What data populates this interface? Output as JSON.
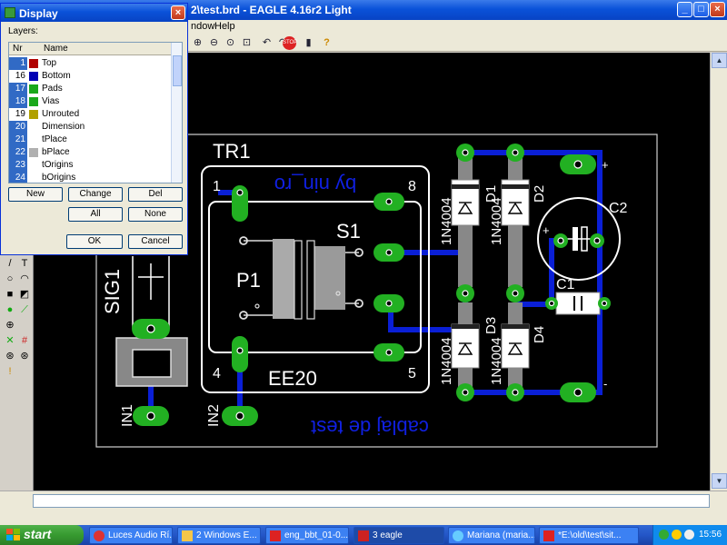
{
  "window": {
    "title": "2\\test.brd - EAGLE 4.16r2 Light"
  },
  "menubar": {
    "items": [
      "ndow",
      "Help"
    ]
  },
  "dialog": {
    "title": "Display",
    "layers_label": "Layers:",
    "columns": {
      "nr": "Nr",
      "name": "Name"
    },
    "layers": [
      {
        "nr": "1",
        "name": "Top",
        "color": "#b00000",
        "selected": true
      },
      {
        "nr": "16",
        "name": "Bottom",
        "color": "#0000b4",
        "selected": false
      },
      {
        "nr": "17",
        "name": "Pads",
        "color": "#1aa81a",
        "selected": true
      },
      {
        "nr": "18",
        "name": "Vias",
        "color": "#1aa81a",
        "selected": true
      },
      {
        "nr": "19",
        "name": "Unrouted",
        "color": "#b0a000",
        "selected": false
      },
      {
        "nr": "20",
        "name": "Dimension",
        "color": "#ffffff",
        "selected": true
      },
      {
        "nr": "21",
        "name": "tPlace",
        "color": "#ffffff",
        "selected": true
      },
      {
        "nr": "22",
        "name": "bPlace",
        "color": "#b0b0b0",
        "selected": true
      },
      {
        "nr": "23",
        "name": "tOrigins",
        "color": "#ffffff",
        "selected": true
      },
      {
        "nr": "24",
        "name": "bOrigins",
        "color": "#ffffff",
        "selected": true
      }
    ],
    "buttons": {
      "new": "New",
      "change": "Change",
      "del": "Del",
      "all": "All",
      "none": "None",
      "ok": "OK",
      "cancel": "Cancel"
    }
  },
  "board": {
    "labels": {
      "tr1": "TR1",
      "pin1": "1",
      "pin8": "8",
      "pin4": "4",
      "pin5": "5",
      "ee20": "EE20",
      "by_nin_ro": "by nin_ro",
      "s1": "S1",
      "p1": "P1",
      "sig1": "SIG1",
      "in1": "IN1",
      "in2": "IN2",
      "cablaj": "cablaj de test",
      "d_1n4004_a": "1N4004",
      "d_1n4004_b": "1N4004",
      "d_1n4004_c": "1N4004",
      "d_1n4004_d": "1N4004",
      "d1": "D1",
      "d2": "D2",
      "d3": "D3",
      "d4": "D4",
      "c2": "C2",
      "c1": "C1",
      "plus_top": "+",
      "plus_c2": "+",
      "minus": "-"
    }
  },
  "taskbar": {
    "start": "start",
    "tasks": [
      "Luces Audio Rí...",
      "2 Windows E...",
      "eng_bbt_01-0...",
      "3 eagle",
      "Mariana (maria...",
      "*E:\\old\\test\\sit..."
    ],
    "clock": "15:56"
  }
}
